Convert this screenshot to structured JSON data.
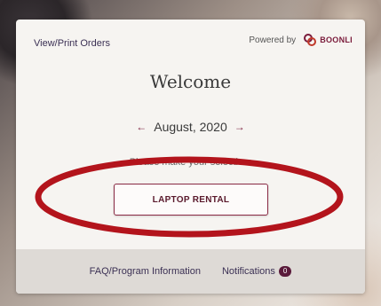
{
  "header": {
    "view_orders_label": "View/Print Orders",
    "powered_by_label": "Powered by",
    "brand_name": "BOONLI"
  },
  "main": {
    "welcome_title": "Welcome",
    "month_label": "August, 2020",
    "prev_arrow": "←",
    "next_arrow": "→",
    "selection_prompt": "Please make your selection:",
    "rental_button_label": "LAPTOP RENTAL"
  },
  "footer": {
    "faq_label": "FAQ/Program Information",
    "notifications_label": "Notifications",
    "notifications_count": "0"
  },
  "colors": {
    "accent": "#7a1b3b",
    "annotation_red": "#b3141c",
    "card_bg": "#f6f4f1",
    "footer_bg": "#dedad6"
  }
}
